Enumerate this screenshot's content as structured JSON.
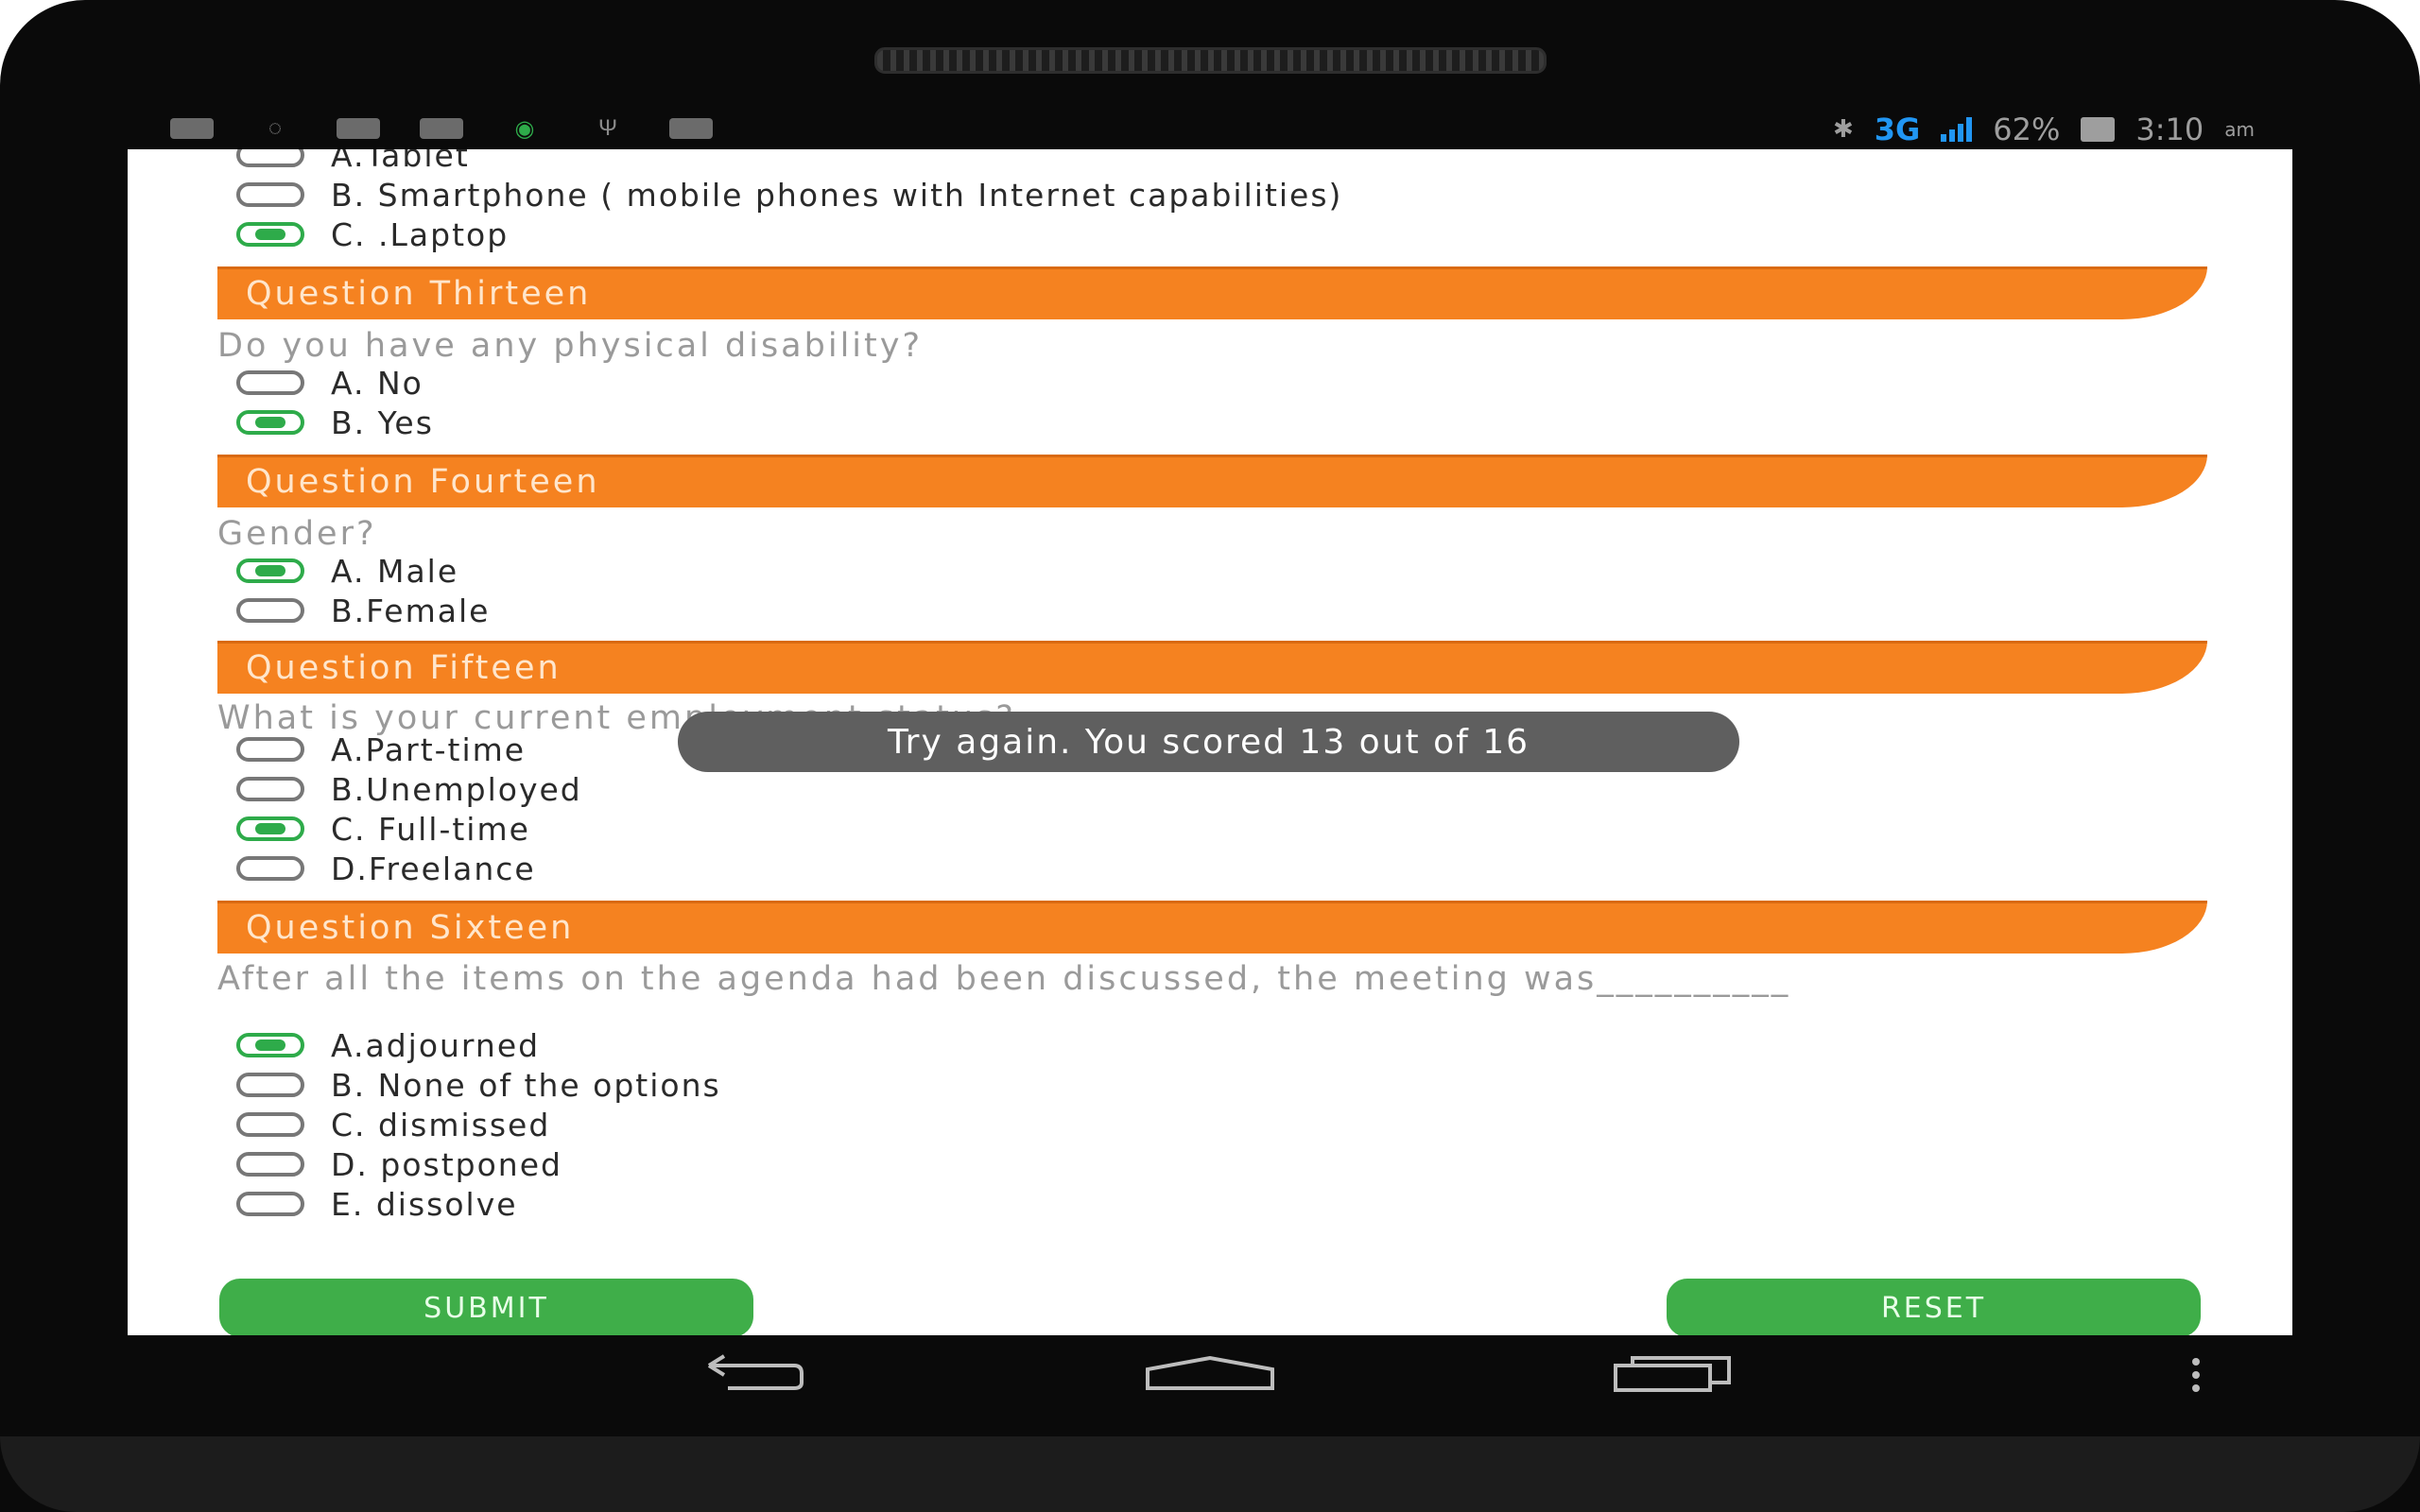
{
  "status_bar": {
    "left_icons": [
      "notification-icon",
      "whatsapp-icon",
      "image-icon",
      "mail-icon",
      "app-icon",
      "usb-icon",
      "barcode-icon"
    ],
    "network": "3G",
    "battery": "62%",
    "time": "3:10",
    "ampm": "am"
  },
  "quiz": {
    "q12_options": [
      {
        "label": "A.Tablet",
        "checked": false
      },
      {
        "label": "B. Smartphone ( mobile phones with Internet capabilities)",
        "checked": false
      },
      {
        "label": "C. .Laptop",
        "checked": true
      }
    ],
    "q13": {
      "header": "Question Thirteen",
      "text": "Do you have any physical disability?",
      "options": [
        {
          "label": "A. No",
          "checked": false
        },
        {
          "label": "B. Yes",
          "checked": true
        }
      ]
    },
    "q14": {
      "header": "Question Fourteen",
      "text": "Gender?",
      "options": [
        {
          "label": "A. Male",
          "checked": true
        },
        {
          "label": "B.Female",
          "checked": false
        }
      ]
    },
    "q15": {
      "header": "Question Fifteen",
      "text": "What is your current employment status?",
      "options": [
        {
          "label": "A.Part-time",
          "checked": false
        },
        {
          "label": "B.Unemployed",
          "checked": false
        },
        {
          "label": "C. Full-time",
          "checked": true
        },
        {
          "label": "D.Freelance",
          "checked": false
        }
      ]
    },
    "q16": {
      "header": "Question Sixteen",
      "text": "After all the items on the agenda had been discussed, the meeting was__________",
      "options": [
        {
          "label": "A.adjourned",
          "checked": true
        },
        {
          "label": "B. None of the options",
          "checked": false
        },
        {
          "label": "C. dismissed",
          "checked": false
        },
        {
          "label": "D. postponed",
          "checked": false
        },
        {
          "label": "E. dissolve",
          "checked": false
        }
      ]
    }
  },
  "toast": "Try again. You scored 13 out of 16",
  "buttons": {
    "submit": "SUBMIT",
    "reset": "RESET"
  },
  "colors": {
    "accent": "#f58220",
    "checked": "#2eab4a",
    "button": "#3fae49"
  }
}
